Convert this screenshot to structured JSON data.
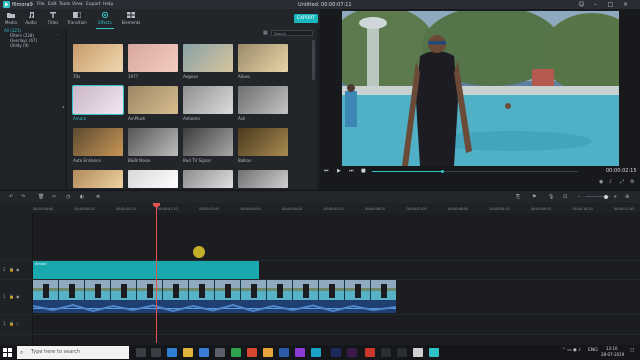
{
  "app": {
    "name": "filmora9",
    "document_title": "Untitled: 00:00:07:11",
    "menu": [
      "File",
      "Edit",
      "Tools",
      "View",
      "Export",
      "Help"
    ]
  },
  "tool_tabs": [
    {
      "label": "Media",
      "icon": "folder-icon"
    },
    {
      "label": "Audio",
      "icon": "music-note-icon"
    },
    {
      "label": "Titles",
      "icon": "text-icon"
    },
    {
      "label": "Transition",
      "icon": "transition-icon"
    },
    {
      "label": "Effects",
      "icon": "effects-icon",
      "active": true
    },
    {
      "label": "Elements",
      "icon": "elements-icon"
    }
  ],
  "export_label": "EXPORT",
  "categories": [
    {
      "label": "All (321)",
      "selected": true
    },
    {
      "label": "Filters (228)"
    },
    {
      "label": "Overlays (67)"
    },
    {
      "label": "Utility (9)"
    }
  ],
  "search_placeholder": "Search",
  "effects": [
    {
      "label": "70s",
      "c1": "#c89a6a",
      "c2": "#f0d8b0"
    },
    {
      "label": "1977",
      "c1": "#d9a7a0",
      "c2": "#f4ccc2"
    },
    {
      "label": "Aegean",
      "c1": "#8aa2a8",
      "c2": "#d6c49c"
    },
    {
      "label": "Allues",
      "c1": "#9a8a6a",
      "c2": "#e8d6a6"
    },
    {
      "label": "Amaro",
      "c1": "#c9b6c8",
      "c2": "#f3e6f1",
      "selected": true
    },
    {
      "label": "AmPlush",
      "c1": "#9c8664",
      "c2": "#d8be8e"
    },
    {
      "label": "Antioma",
      "c1": "#8f8f8f",
      "c2": "#dcdcdc"
    },
    {
      "label": "Ash",
      "c1": "#6e6e6e",
      "c2": "#c4c4c4"
    },
    {
      "label": "Auto Enhance",
      "c1": "#5c4a30",
      "c2": "#c89656"
    },
    {
      "label": "B&W Noise",
      "c1": "#555555",
      "c2": "#bcbcbc"
    },
    {
      "label": "Bad TV Signal",
      "c1": "#3c3c3c",
      "c2": "#a8a8a8"
    },
    {
      "label": "Balkan",
      "c1": "#4a3a1e",
      "c2": "#a88a50"
    },
    {
      "label": "",
      "c1": "#b08a5c",
      "c2": "#f0d2a0"
    },
    {
      "label": "",
      "c1": "#d8d8d8",
      "c2": "#ffffff"
    },
    {
      "label": "",
      "c1": "#8c8c8c",
      "c2": "#e0e0e0"
    },
    {
      "label": "",
      "c1": "#707070",
      "c2": "#d0d0d0"
    }
  ],
  "preview": {
    "timecode": "00:00:02:15",
    "progress": 0.34
  },
  "timeline": {
    "ruler_ticks": [
      "00:00:00:00",
      "00:00:00:20",
      "00:00:01:15",
      "00:00:02:10",
      "00:00:03:05",
      "00:00:04:00",
      "00:00:04:20",
      "00:00:05:15",
      "00:00:06:10",
      "00:00:07:05",
      "00:00:08:00",
      "00:00:08:20",
      "00:00:09:15",
      "00:00:10:10",
      "00:00:11:05"
    ],
    "effect_clip_label": "Amaro",
    "track_labels": [
      "2",
      "1",
      "1"
    ],
    "zoom": 0.85
  },
  "taskbar": {
    "search_placeholder": "Type here to search",
    "lang": "ENG",
    "time": "13:10",
    "date": "28-07-2019"
  },
  "colors": {
    "accent": "#32c4c9",
    "playhead": "#e2524f",
    "effect_clip": "#19a8ae",
    "audio_clip": "#1f3f73"
  }
}
